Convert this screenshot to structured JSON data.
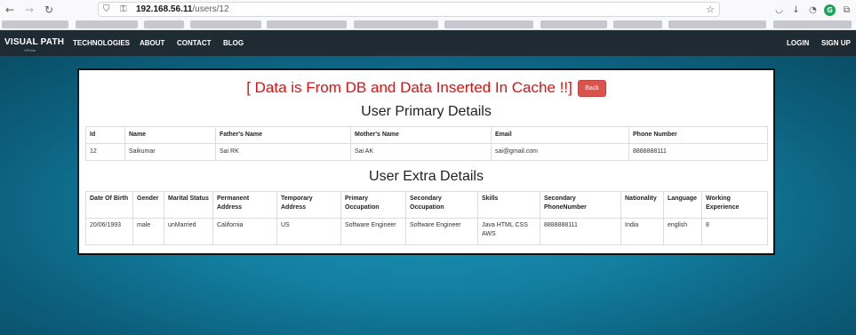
{
  "browser": {
    "url_host": "192.168.56.11",
    "url_path": "/users/12",
    "icons": [
      "back-arrow-icon",
      "forward-arrow-icon",
      "reload-icon",
      "shield-icon",
      "lock-icon",
      "star-icon",
      "pocket-icon",
      "download-icon",
      "grammarly-icon",
      "extensions-icon",
      "account-icon",
      "menu-icon"
    ]
  },
  "nav": {
    "brand": "VISUAL PATH",
    "brand_sub": "VPrime",
    "links": [
      "TECHNOLOGIES",
      "ABOUT",
      "CONTACT",
      "BLOG"
    ],
    "login": "LOGIN",
    "signup": "SIGN UP"
  },
  "panel": {
    "cache_message": "[ Data is From DB and Data Inserted In Cache !!]",
    "back_label": "Back",
    "primary_title": "User Primary Details",
    "extra_title": "User Extra Details"
  },
  "primary_table": {
    "headers": [
      "Id",
      "Name",
      "Father's Name",
      "Mother's Name",
      "Email",
      "Phone Number"
    ],
    "row": [
      "12",
      "Saikumar",
      "Sai RK",
      "Sai AK",
      "sai@gmail.com",
      "8888888111"
    ]
  },
  "extra_table": {
    "headers": [
      "Date Of Birth",
      "Gender",
      "Marital Status",
      "Permanent Address",
      "Temporary Address",
      "Primary Occupation",
      "Secondary Occupation",
      "Skills",
      "Secondary PhoneNumber",
      "Nationality",
      "Language",
      "Working Experience"
    ],
    "row": [
      "20/06/1993",
      "male",
      "unMarried",
      "California",
      "US",
      "Software Engineer",
      "Software Engineer",
      "Java HTML CSS AWS",
      "8888888111",
      "India",
      "english",
      "8"
    ]
  },
  "colors": {
    "cache_message": "#e01010",
    "back_button": "#d9534f",
    "navbar": "#1f2b33",
    "backdrop": "#137ea0"
  }
}
